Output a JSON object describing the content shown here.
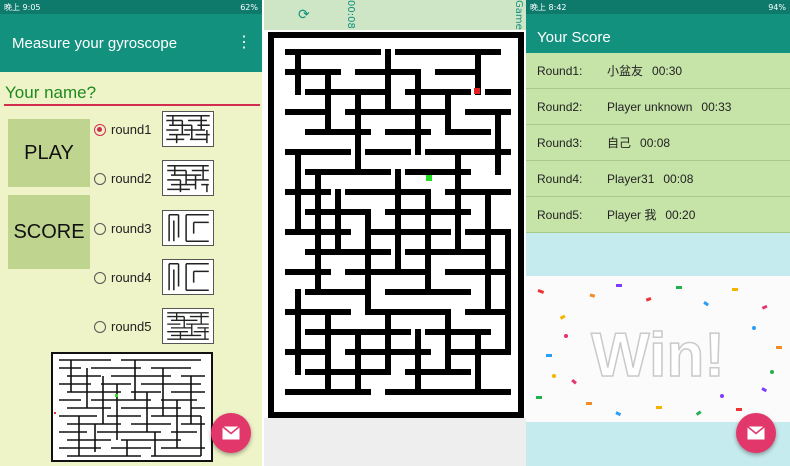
{
  "panel1": {
    "status": {
      "left": "晚上 9:05",
      "right": "62%"
    },
    "title": "Measure your gyroscope",
    "name_label": "Your name?",
    "play_label": "PLAY",
    "score_label": "SCORE",
    "rounds": [
      {
        "label": "round1",
        "selected": true
      },
      {
        "label": "round2",
        "selected": false
      },
      {
        "label": "round3",
        "selected": false
      },
      {
        "label": "round4",
        "selected": false
      },
      {
        "label": "round5",
        "selected": false
      }
    ]
  },
  "panel2": {
    "rotated_status": {
      "time": "00:08",
      "label": "Game"
    }
  },
  "panel3": {
    "status": {
      "left": "晚上 8:42",
      "right": "94%"
    },
    "title": "Your Score",
    "scores": [
      {
        "round": "Round1:",
        "player": "小盆友",
        "time": "00:30"
      },
      {
        "round": "Round2:",
        "player": "Player unknown",
        "time": "00:33"
      },
      {
        "round": "Round3:",
        "player": "自己",
        "time": "00:08"
      },
      {
        "round": "Round4:",
        "player": "Player31",
        "time": "00:08"
      },
      {
        "round": "Round5:",
        "player": "Player 我",
        "time": "00:20"
      }
    ],
    "win_text": "Win!"
  },
  "colors": {
    "primary": "#12917f",
    "accent": "#e2376b",
    "button": "#bfd48f",
    "score_bg": "#c6e3a8"
  }
}
